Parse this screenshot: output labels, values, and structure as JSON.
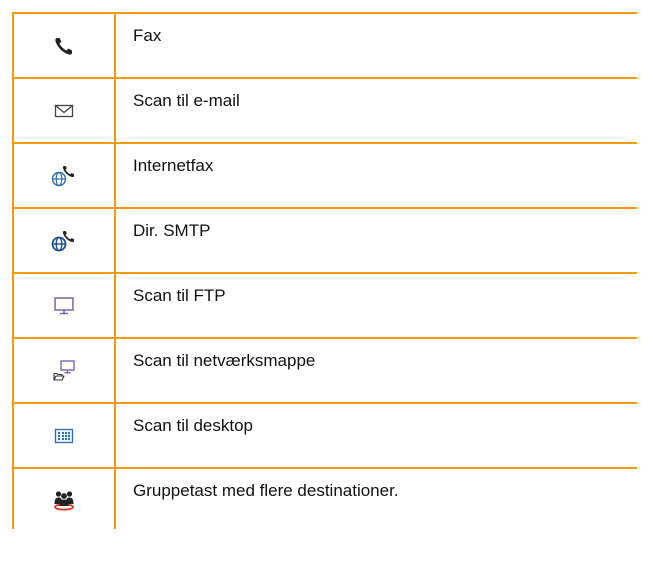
{
  "colors": {
    "grid": "#f59a0c",
    "icon_dark": "#222222",
    "icon_blue": "#2f6fb6",
    "icon_purple": "#6f59b5",
    "icon_red": "#d9342b"
  },
  "rows": [
    {
      "icon": "fax-icon",
      "label": "Fax"
    },
    {
      "icon": "email-envelope-icon",
      "label": "Scan til e-mail"
    },
    {
      "icon": "internet-fax-icon",
      "label": "Internetfax"
    },
    {
      "icon": "direct-smtp-icon",
      "label": "Dir. SMTP"
    },
    {
      "icon": "ftp-monitor-icon",
      "label": "Scan til FTP"
    },
    {
      "icon": "network-folder-icon",
      "label": "Scan til netværksmappe"
    },
    {
      "icon": "desktop-icon",
      "label": "Scan til desktop"
    },
    {
      "icon": "group-key-icon",
      "label": "Gruppetast med flere destinationer."
    }
  ]
}
